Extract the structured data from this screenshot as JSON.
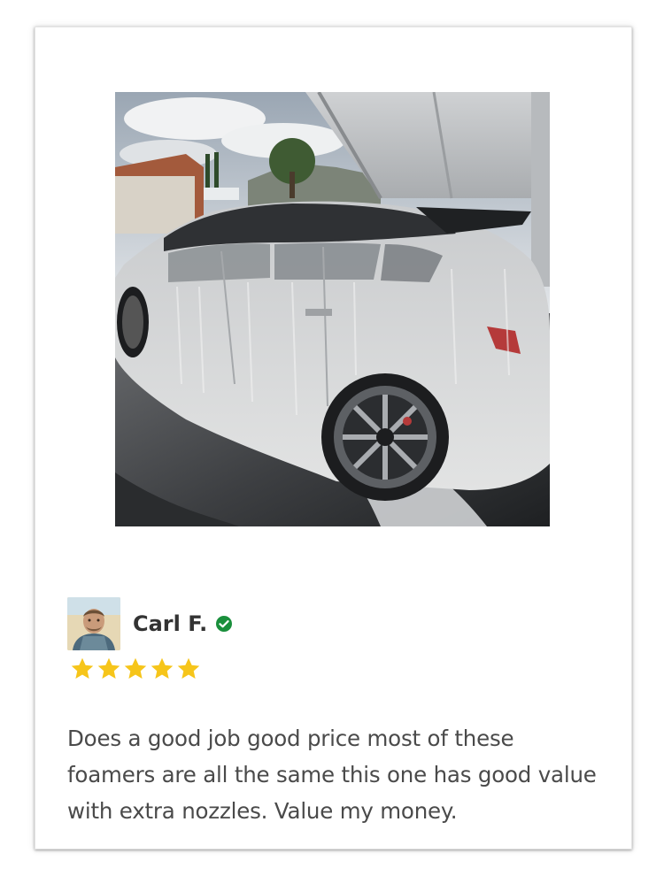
{
  "review": {
    "photo_icon": "car-foam-wash-photo",
    "avatar_icon": "reviewer-avatar",
    "reviewer_name": "Carl F.",
    "verified_icon": "verified-check-icon",
    "rating": 5,
    "rating_max": 5,
    "text": "Does a good job good price most of these foamers are all the same this one has good value with extra nozzles. Value my money."
  },
  "colors": {
    "star": "#f6c51a",
    "verified": "#1a8f3c",
    "name": "#333333",
    "text": "#4a4a4a"
  }
}
